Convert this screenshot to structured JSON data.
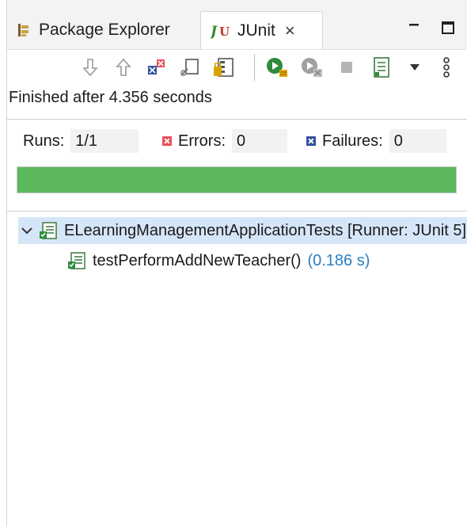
{
  "tabs": {
    "package_explorer": {
      "label": "Package Explorer",
      "icon": "package-explorer-icon"
    },
    "junit": {
      "label": "JUnit",
      "icon": "junit-icon",
      "close": "×"
    }
  },
  "window_controls": {
    "minimize": "minimize-icon",
    "maximize": "maximize-icon"
  },
  "toolbar": {
    "buttons": [
      "next-failure-icon",
      "previous-failure-icon",
      "show-failures-only-icon",
      "scroll-lock-icon",
      "show-skipped-icon",
      "rerun-icon",
      "rerun-failed-first-icon",
      "stop-icon",
      "test-run-history-icon",
      "view-menu-icon",
      "more-options-icon"
    ]
  },
  "status": {
    "text": "Finished after 4.356 seconds"
  },
  "counters": {
    "runs_label": "Runs:",
    "runs_value": "1/1",
    "errors_label": "Errors:",
    "errors_value": "0",
    "failures_label": "Failures:",
    "failures_value": "0"
  },
  "progress": {
    "percent": 100,
    "color": "#5cb85c"
  },
  "tree": {
    "root_label": "ELearningManagementApplicationTests [Runner: JUnit 5]",
    "child_label": "testPerformAddNewTeacher()",
    "child_time": "(0.186 s)"
  },
  "colors": {
    "selection": "#d5e6f8",
    "time": "#2a7fc1",
    "error": "#e6515c",
    "failure": "#33519c"
  }
}
